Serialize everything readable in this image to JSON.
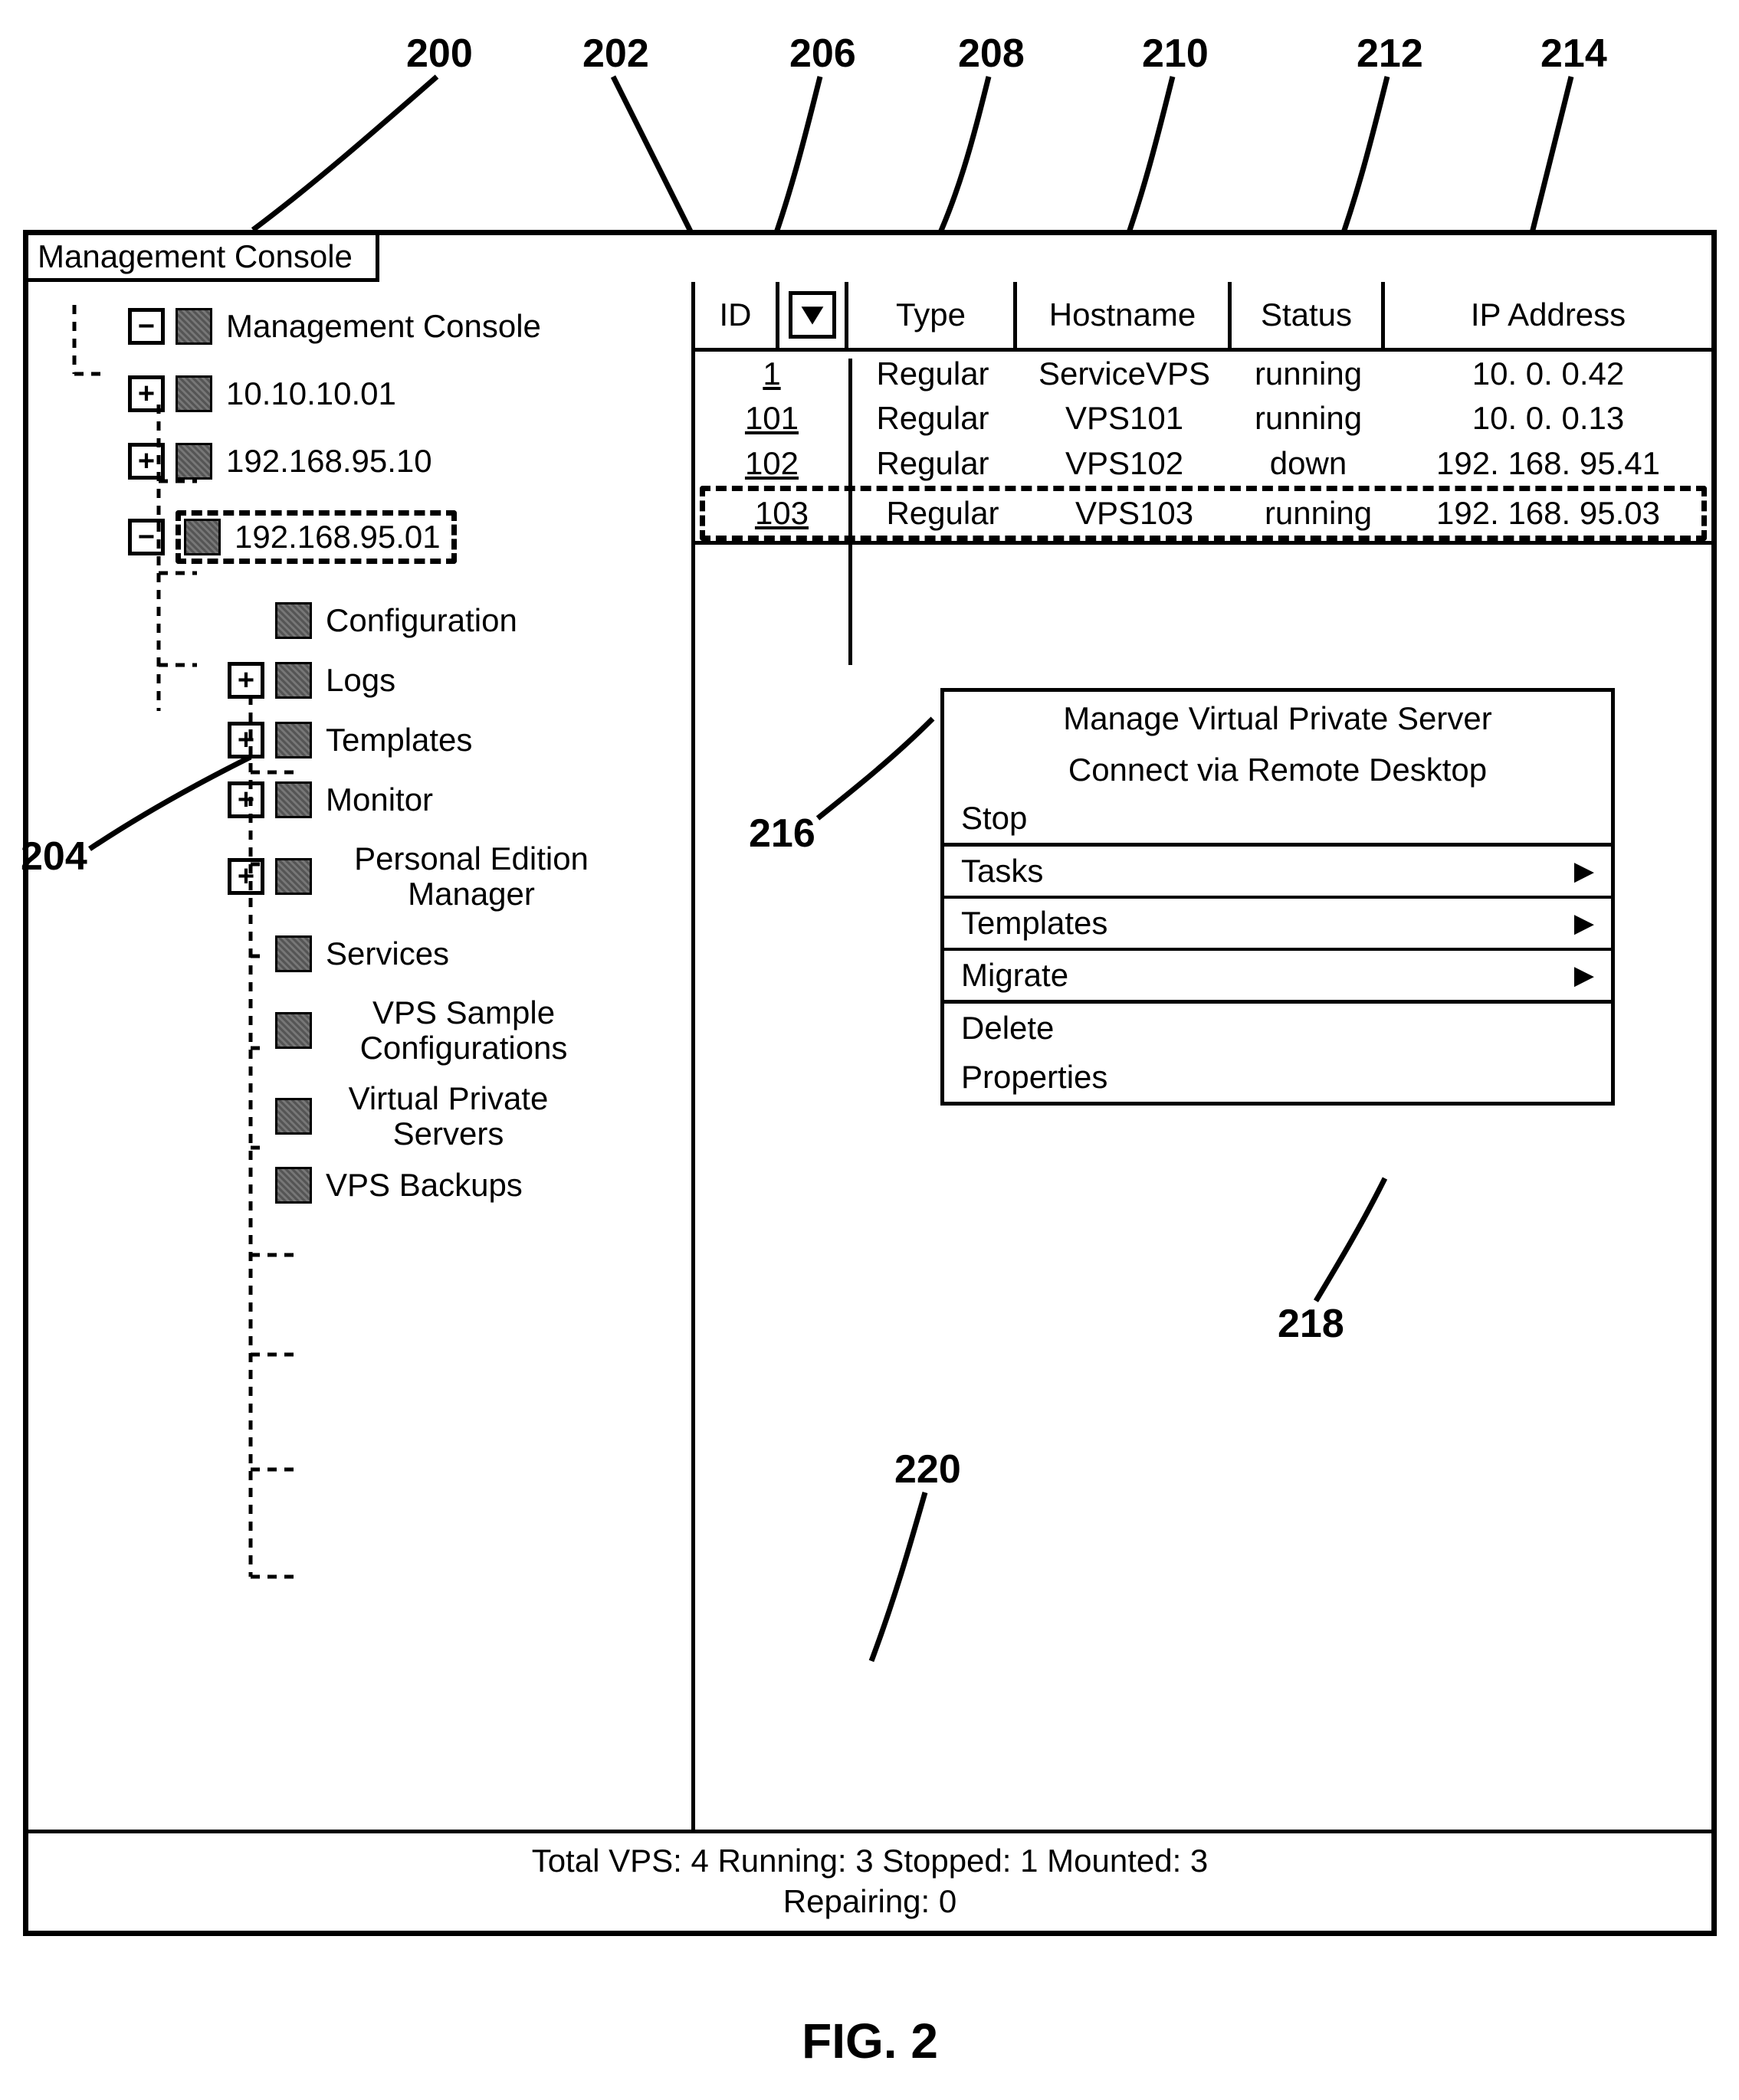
{
  "callouts": {
    "c200": "200",
    "c202": "202",
    "c204": "204",
    "c206": "206",
    "c208": "208",
    "c210": "210",
    "c212": "212",
    "c214": "214",
    "c216": "216",
    "c218": "218",
    "c220": "220"
  },
  "window": {
    "title": "Management Console"
  },
  "tree": {
    "root": "Management Console",
    "host1": "10.10.10.01",
    "host2": "192.168.95.10",
    "host3": "192.168.95.01",
    "children": {
      "configuration": "Configuration",
      "logs": "Logs",
      "templates": "Templates",
      "monitor": "Monitor",
      "pe_manager": "Personal Edition Manager",
      "services": "Services",
      "sample_cfg": "VPS Sample Configurations",
      "vps": "Virtual Private Servers",
      "backups": "VPS Backups"
    }
  },
  "table": {
    "headers": {
      "id": "ID",
      "type": "Type",
      "hostname": "Hostname",
      "status": "Status",
      "ip": "IP Address"
    },
    "rows": [
      {
        "id": "1",
        "type": "Regular",
        "hostname": "ServiceVPS",
        "status": "running",
        "ip": "10. 0. 0.42"
      },
      {
        "id": "101",
        "type": "Regular",
        "hostname": "VPS101",
        "status": "running",
        "ip": "10. 0. 0.13"
      },
      {
        "id": "102",
        "type": "Regular",
        "hostname": "VPS102",
        "status": "down",
        "ip": "192. 168. 95.41"
      },
      {
        "id": "103",
        "type": "Regular",
        "hostname": "VPS103",
        "status": "running",
        "ip": "192. 168. 95.03"
      }
    ]
  },
  "context_menu": {
    "manage": "Manage Virtual Private Server",
    "connect": "Connect via Remote Desktop",
    "stop": "Stop",
    "tasks": "Tasks",
    "templates": "Templates",
    "migrate": "Migrate",
    "delete": "Delete",
    "properties": "Properties"
  },
  "status_bar": {
    "line1": "Total VPS: 4 Running: 3 Stopped: 1 Mounted: 3",
    "line2": "Repairing: 0"
  },
  "figure": "FIG. 2"
}
